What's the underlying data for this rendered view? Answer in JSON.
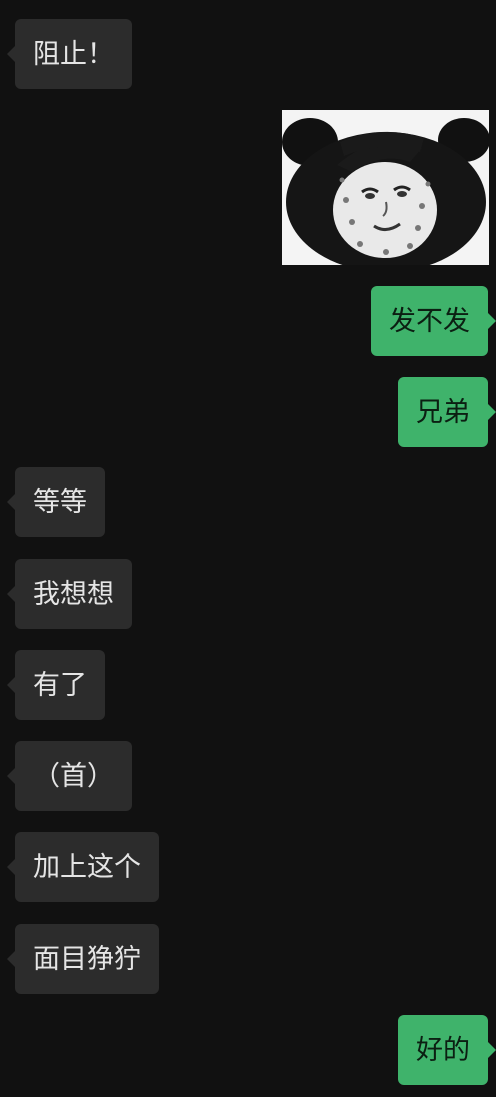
{
  "messages": [
    {
      "direction": "incoming",
      "type": "text",
      "text": "阻止！"
    },
    {
      "direction": "outgoing",
      "type": "sticker",
      "sticker_icon": "panda-meme-face-icon"
    },
    {
      "direction": "outgoing",
      "type": "text",
      "text": "发不发"
    },
    {
      "direction": "outgoing",
      "type": "text",
      "text": "兄弟"
    },
    {
      "direction": "incoming",
      "type": "text",
      "text": "等等"
    },
    {
      "direction": "incoming",
      "type": "text",
      "text": "我想想"
    },
    {
      "direction": "incoming",
      "type": "text",
      "text": "有了"
    },
    {
      "direction": "incoming",
      "type": "text",
      "text": "（首）"
    },
    {
      "direction": "incoming",
      "type": "text",
      "text": "加上这个"
    },
    {
      "direction": "incoming",
      "type": "text",
      "text": "面目狰狞"
    },
    {
      "direction": "outgoing",
      "type": "text",
      "text": "好的"
    }
  ],
  "colors": {
    "background": "#111111",
    "incoming_bubble": "#2c2c2c",
    "incoming_text": "#e5e5e5",
    "outgoing_bubble": "#3fb36b",
    "outgoing_text": "#0b1f12"
  }
}
